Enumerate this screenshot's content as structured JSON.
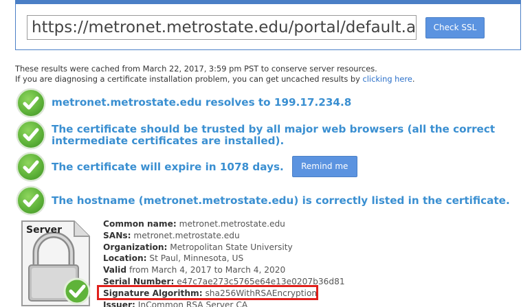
{
  "search": {
    "url_value": "https://metronet.metrostate.edu/portal/default.aspx",
    "check_button": "Check SSL"
  },
  "cache_note": {
    "line1": "These results were cached from March 22, 2017, 3:59 pm PST to conserve server resources.",
    "line2_prefix": "If you are diagnosing a certificate installation problem, you can get uncached results by ",
    "line2_link": "clicking here",
    "line2_suffix": "."
  },
  "results": [
    {
      "text": "metronet.metrostate.edu resolves to 199.17.234.8"
    },
    {
      "text": "The certificate should be trusted by all major web browsers (all the correct intermediate certificates are installed)."
    },
    {
      "text": "The certificate will expire in 1078 days."
    },
    {
      "text": "The hostname (metronet.metrostate.edu) is correctly listed in the certificate."
    }
  ],
  "remind_button": "Remind me",
  "server_graphic": {
    "label": "Server"
  },
  "cert": {
    "common_name": {
      "label": "Common name:",
      "value": "metronet.metrostate.edu"
    },
    "sans": {
      "label": "SANs:",
      "value": "metronet.metrostate.edu"
    },
    "organization": {
      "label": "Organization:",
      "value": "Metropolitan State University"
    },
    "location": {
      "label": "Location:",
      "value": "St Paul, Minnesota, US"
    },
    "valid": {
      "label": "Valid",
      "value": "from March 4, 2017 to March 4, 2020"
    },
    "serial": {
      "label": "Serial Number:",
      "value": "e47c7ae273c5765e64e13e0207b36d81"
    },
    "sig_alg": {
      "label": "Signature Algorithm:",
      "value": "sha256WithRSAEncryption"
    },
    "issuer": {
      "label": "Issuer:",
      "value": "InCommon RSA Server CA"
    }
  },
  "colors": {
    "panel_border": "#4a7fc6",
    "button": "#5b93e0",
    "result_text": "#3a8fd1",
    "check_green": "#5fb33a",
    "highlight": "#e0201c"
  },
  "icons": [
    "green-check-icon",
    "server-lock-icon"
  ]
}
